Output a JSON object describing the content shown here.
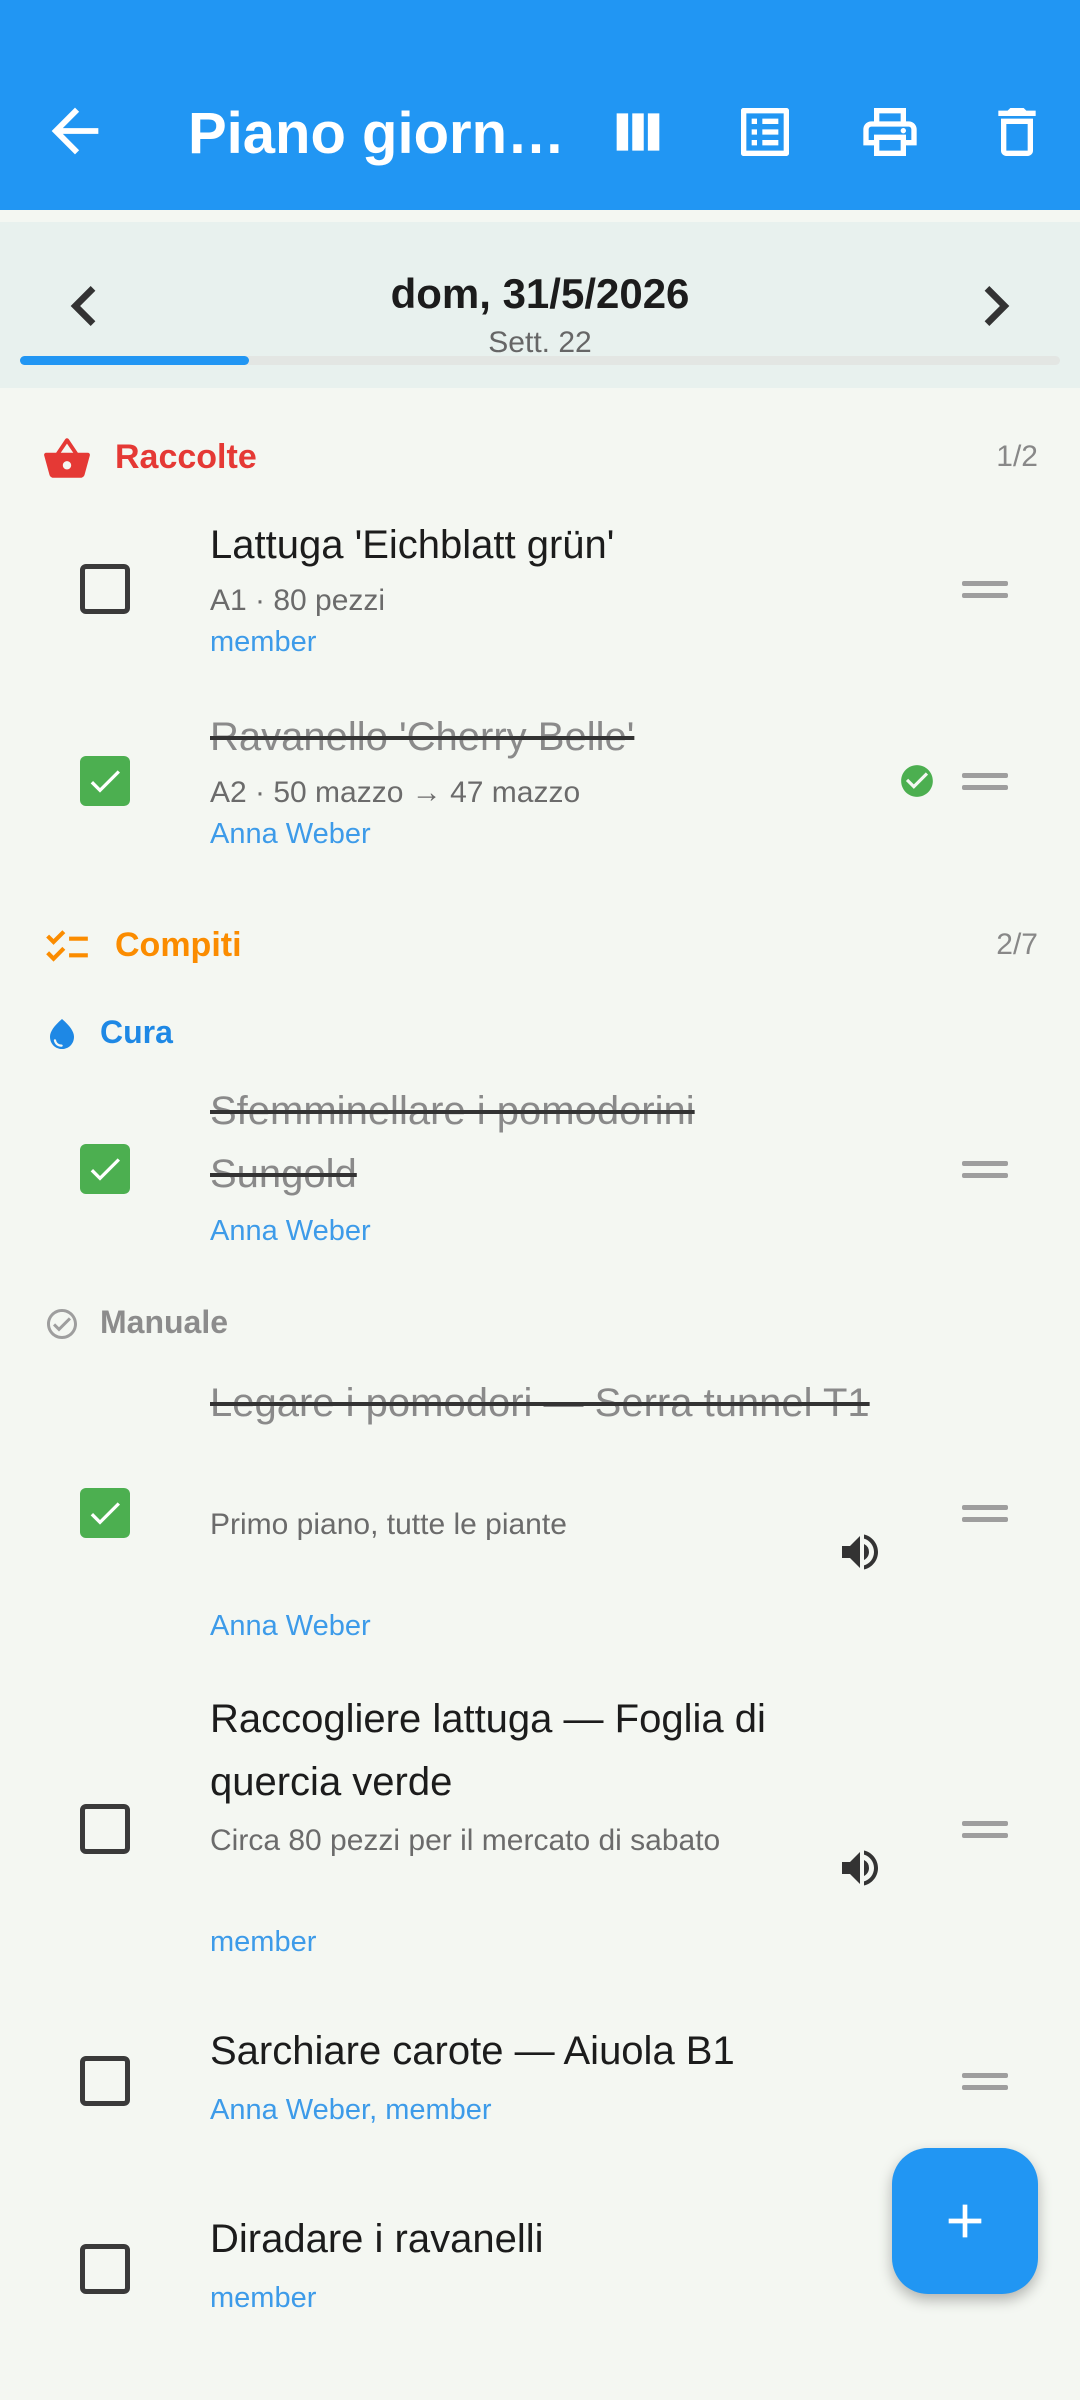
{
  "appbar": {
    "title": "Piano giorn…",
    "icons": [
      "arrow-back-icon",
      "columns-view-icon",
      "list-view-icon",
      "print-icon",
      "delete-icon"
    ],
    "color": "#2196f3"
  },
  "datebar": {
    "date": "dom, 31/5/2026",
    "week": "Sett. 22",
    "progress": 0.22
  },
  "harvests": {
    "label": "Raccolte",
    "count": "1/2",
    "color": "#e53935",
    "items": [
      {
        "title": "Lattuga 'Eichblatt grün'",
        "detail": "A1 · 80 pezzi",
        "assignee": "member",
        "done": false
      },
      {
        "title": "Ravanello 'Cherry Belle'",
        "detail": "A2 · 50 mazzo → 47 mazzo",
        "assignee": "Anna Weber",
        "done": true
      }
    ]
  },
  "tasks": {
    "label": "Compiti",
    "count": "2/7",
    "color": "#fb8c00",
    "care": {
      "label": "Cura",
      "items": [
        {
          "title": "Sfemminellare i pomodorini Sungold",
          "assignee": "Anna Weber",
          "done": true
        }
      ]
    },
    "manual": {
      "label": "Manuale",
      "items": [
        {
          "title": "Legare i pomodori — Serra tunnel T1",
          "note": "Primo piano, tutte le piante",
          "assignee": "Anna Weber",
          "done": true
        },
        {
          "title": "Raccogliere lattuga — Foglia di quercia verde",
          "note": "Circa 80 pezzi per il mercato di sabato",
          "assignee": "member",
          "done": false
        },
        {
          "title": "Sarchiare carote — Aiuola B1",
          "assignee": "Anna Weber, member",
          "done": false
        },
        {
          "title": "Diradare i ravanelli",
          "assignee": "member",
          "done": false
        }
      ]
    }
  },
  "fab": {
    "icon": "add-icon"
  }
}
